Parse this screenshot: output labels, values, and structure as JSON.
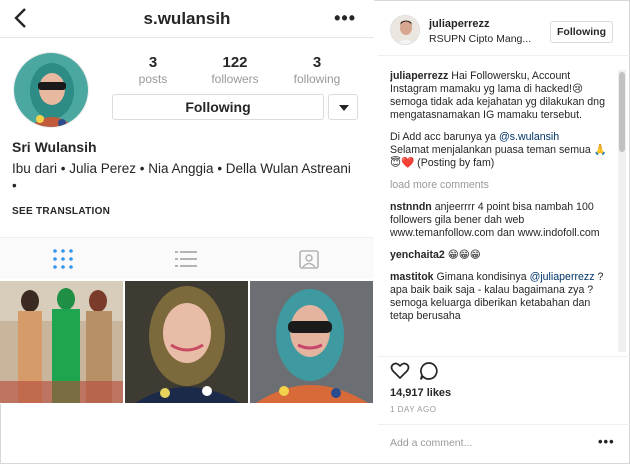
{
  "profile": {
    "username": "s.wulansih",
    "stats": [
      {
        "num": "3",
        "label": "posts"
      },
      {
        "num": "122",
        "label": "followers"
      },
      {
        "num": "3",
        "label": "following"
      }
    ],
    "following_button": "Following",
    "full_name": "Sri Wulansih",
    "bio": "Ibu dari • Julia Perez • Nia Anggia • Della Wulan Astreani •",
    "see_translation": "SEE TRANSLATION"
  },
  "icons": {
    "back": "back-arrow-icon",
    "more": "more-options-icon",
    "grid": "grid-view-icon",
    "list": "list-view-icon",
    "tagged": "tagged-icon",
    "dropdown": "chevron-down-icon",
    "like": "heart-icon",
    "comment": "comment-icon"
  },
  "post": {
    "author": "juliaperrezz",
    "location": "RSUPN Cipto Mang...",
    "follow_button": "Following",
    "caption_user": "juliaperrezz",
    "caption_1": " Hai Followersku, Account Instagram mamaku yg lama di hacked!😢 semoga tidak ada kejahatan yg dilakukan dng mengatasnamakan IG mamaku tersebut.",
    "caption_2a": "Di Add acc barunya ya ",
    "caption_2_mention": "@s.wulansih",
    "caption_3": "Selamat menjalankan puasa teman semua 🙏😇❤️ (Posting by fam)",
    "load_more": "load more comments",
    "comments": [
      {
        "user": "nstnndn",
        "text": " anjeerrrr 4 point bisa nambah 100 followers gila bener dah web www.temanfollow.com dan www.indofoll.com"
      },
      {
        "user": "yenchaita2",
        "text": " 😁😁😁"
      },
      {
        "user": "mastitok",
        "text_pre": " Gimana kondisinya ",
        "mention": "@juliaperrezz",
        "text_post": " ? apa baik baik saja - kalau bagaimana zya ? semoga keluarga diberikan ketabahan dan tetap berusaha"
      }
    ],
    "likes": "14,917 likes",
    "time_ago": "1 DAY AGO",
    "add_comment_placeholder": "Add a comment...",
    "more_glyph": "•••"
  },
  "colors": {
    "link": "#003569",
    "muted": "#999999",
    "border": "#dbdbdb"
  }
}
